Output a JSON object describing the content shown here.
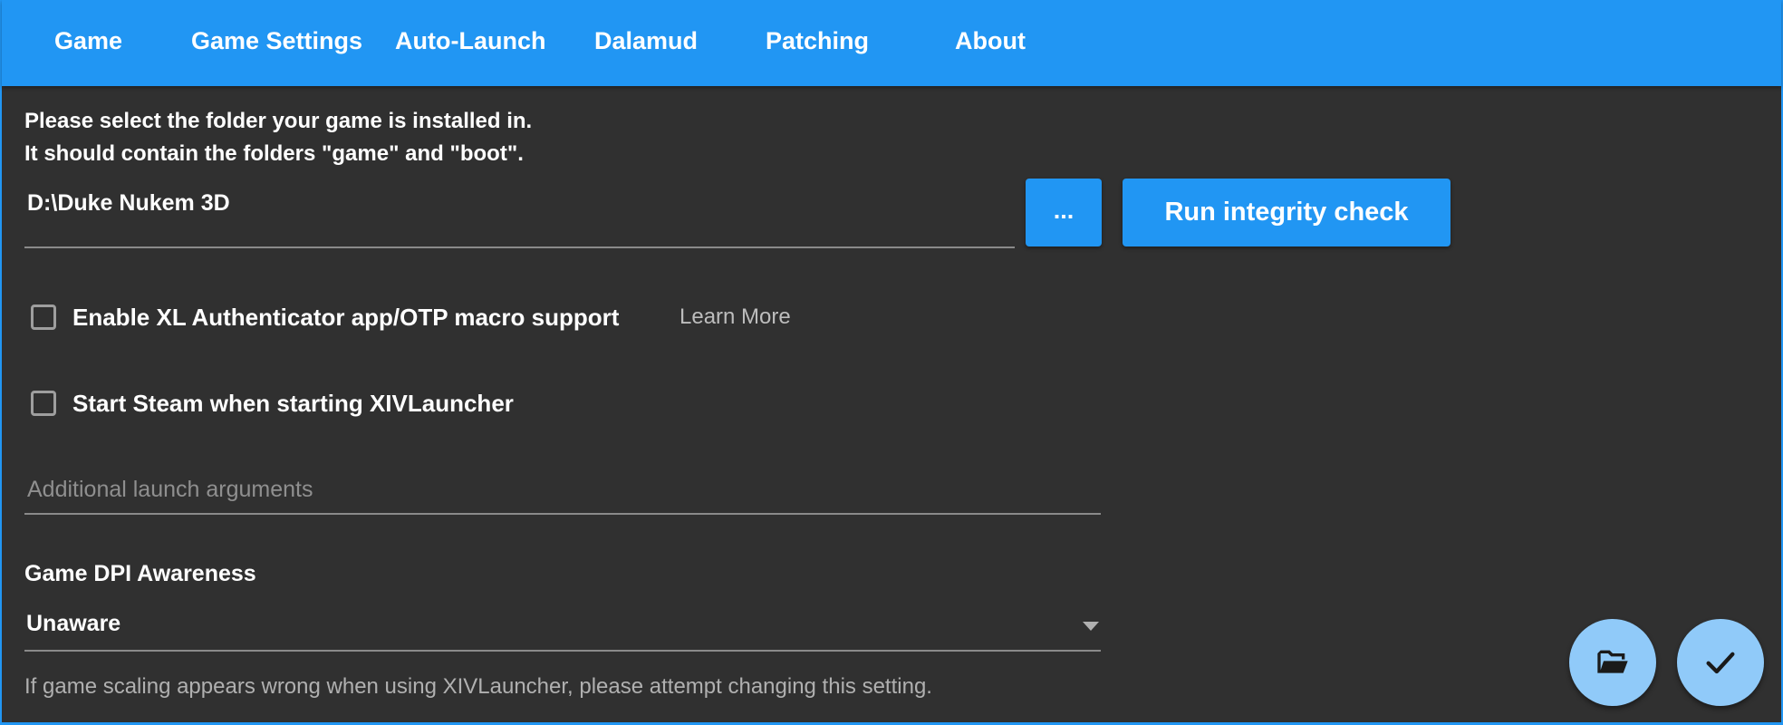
{
  "tabs": [
    {
      "label": "Game"
    },
    {
      "label": "Game Settings"
    },
    {
      "label": "Auto-Launch"
    },
    {
      "label": "Dalamud"
    },
    {
      "label": "Patching"
    },
    {
      "label": "About"
    }
  ],
  "game_folder": {
    "instructions_line1": "Please select the folder your game is installed in.",
    "instructions_line2": "It should contain the folders \"game\" and \"boot\".",
    "path_value": "D:\\Duke Nukem 3D",
    "browse_label": "...",
    "integrity_label": "Run integrity check"
  },
  "options": {
    "otp_label": "Enable XL Authenticator app/OTP macro support",
    "learn_more_label": "Learn More",
    "steam_label": "Start Steam when starting XIVLauncher"
  },
  "launch_args": {
    "placeholder": "Additional launch arguments"
  },
  "dpi": {
    "label": "Game DPI Awareness",
    "selected": "Unaware",
    "hint": "If game scaling appears wrong when using XIVLauncher, please attempt changing this setting."
  },
  "icons": {
    "browse_fab": "folder-open-icon",
    "accept_fab": "checkmark-icon",
    "dropdown": "triangle-down-icon"
  },
  "colors": {
    "accent": "#2196f3",
    "background": "#303030",
    "fab": "#90caf9"
  }
}
